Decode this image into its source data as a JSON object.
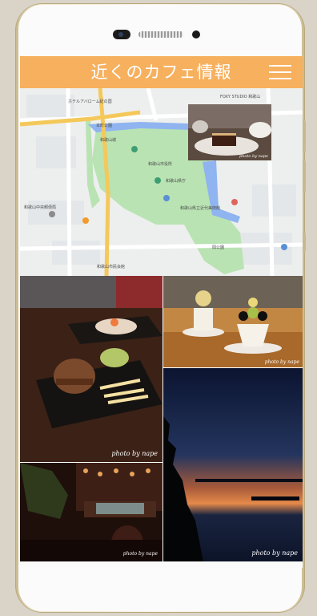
{
  "app": {
    "title": "近くのカフェ情報",
    "accent_color": "#f6b05e",
    "menu_icon": "hamburger-menu-icon"
  },
  "map": {
    "landmarks": [
      "和歌山城",
      "和歌山市役所",
      "和歌山県庁",
      "ホテルアバローム紀の国",
      "和歌山県立近代美術館",
      "岡公園",
      "和歌山市民会館",
      "FOXY STUDIO 和歌山",
      "本町公園",
      "和歌山中央郵便局"
    ],
    "inset_photo_caption": "photo by nape"
  },
  "photos": [
    {
      "id": "burger",
      "subject": "hamburger and fries on wooden table",
      "credit": "photo by nape"
    },
    {
      "id": "parfait",
      "subject": "fruit parfait dessert",
      "credit": "photo by nape"
    },
    {
      "id": "sunset",
      "subject": "sunset silhouette over water",
      "credit": "photo by nape"
    },
    {
      "id": "cafe-interior",
      "subject": "dim cafe interior",
      "credit": "photo by nape"
    }
  ]
}
